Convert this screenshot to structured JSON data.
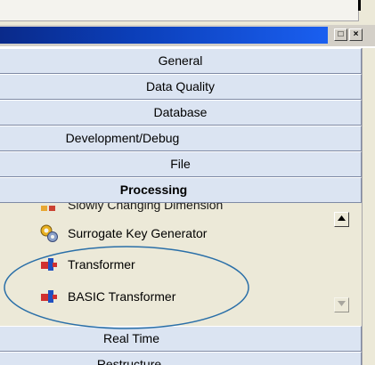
{
  "titlebar": {
    "restore_icon": "restore-icon",
    "close_icon": "close-icon",
    "accent_color": "#0b3eb8"
  },
  "groups": [
    {
      "label": "General"
    },
    {
      "label": "Data Quality"
    },
    {
      "label": "Database"
    },
    {
      "label": "Development/Debug"
    },
    {
      "label": "File"
    },
    {
      "label": "Processing",
      "active": true
    }
  ],
  "processing_items": [
    {
      "label": "Slowly Changing Dimension",
      "icon": "slowly-changing-dimension-icon"
    },
    {
      "label": "Surrogate Key Generator",
      "icon": "surrogate-key-generator-icon"
    },
    {
      "label": "Transformer",
      "icon": "transformer-icon"
    },
    {
      "label": "BASIC Transformer",
      "icon": "basic-transformer-icon"
    }
  ],
  "groups_below": [
    {
      "label": "Real Time"
    },
    {
      "label": "Restructure"
    }
  ],
  "annotation": {
    "color": "#2a6fa8"
  }
}
